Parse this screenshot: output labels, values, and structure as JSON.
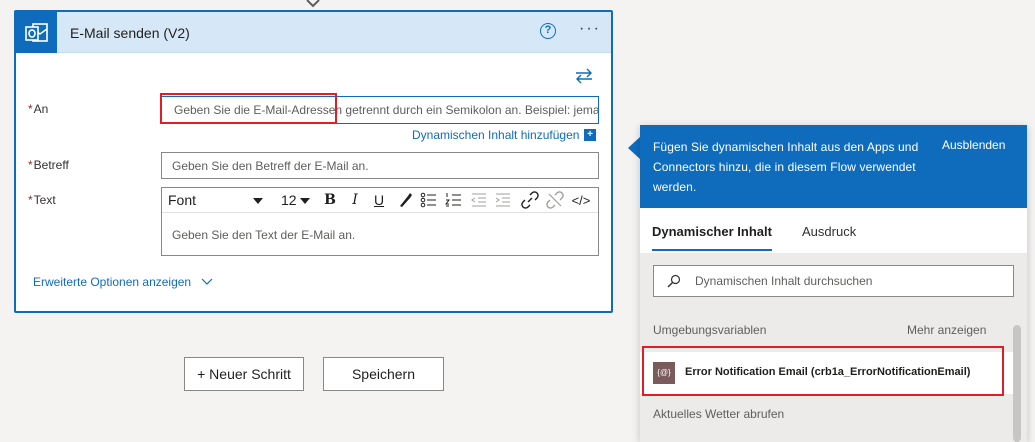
{
  "card": {
    "title": "E-Mail senden (V2)",
    "help_label": "?",
    "more_label": "···"
  },
  "fields": {
    "to": {
      "label": "An",
      "required_mark": "*",
      "placeholder": "Geben Sie die E-Mail-Adressen getrennt durch ein Semikolon an. Beispiel: jemand@"
    },
    "dynamic_link": "Dynamischen Inhalt hinzufügen",
    "dynamic_plus": "+",
    "subject": {
      "label": "Betreff",
      "required_mark": "*",
      "placeholder": "Geben Sie den Betreff der E-Mail an."
    },
    "body": {
      "label": "Text",
      "required_mark": "*",
      "placeholder": "Geben Sie den Text der E-Mail an."
    }
  },
  "toolbar": {
    "font": "Font",
    "size": "12",
    "bold": "B",
    "italic": "I",
    "underline": "U",
    "code": "</>"
  },
  "advanced": "Erweiterte Optionen anzeigen",
  "buttons": {
    "new_step": "+ Neuer Schritt",
    "save": "Speichern"
  },
  "panel": {
    "description": "Fügen Sie dynamischen Inhalt aus den Apps und Connectors hinzu, die in diesem Flow verwendet werden.",
    "hide": "Ausblenden",
    "tabs": [
      "Dynamischer Inhalt",
      "Ausdruck"
    ],
    "active_tab": 0,
    "search_placeholder": "Dynamischen Inhalt durchsuchen",
    "sections": [
      {
        "name": "Umgebungsvariablen",
        "more": "Mehr anzeigen"
      },
      {
        "name": "Aktuelles Wetter abrufen"
      }
    ],
    "items": [
      {
        "icon_text": "{@}",
        "label": "Error Notification Email (crb1a_ErrorNotificationEmail)"
      }
    ]
  },
  "colors": {
    "accent": "#0f6cbd",
    "highlight": "#e01e26",
    "header_bg": "#d6e8f7"
  },
  "icons": [
    "outlook-icon",
    "help-icon",
    "more-icon",
    "swap-icon",
    "search-icon",
    "chevron-down-icon"
  ]
}
